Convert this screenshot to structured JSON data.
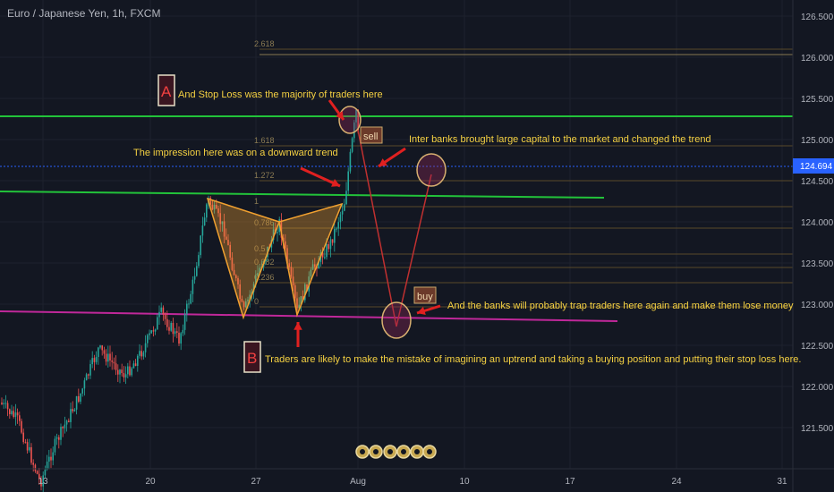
{
  "header": {
    "symbol_title": "Euro / Japanese Yen, 1h, FXCM"
  },
  "price_label": "124.694",
  "chart_data": {
    "type": "candlestick",
    "title": "Euro / Japanese Yen, 1h, FXCM",
    "ylim": [
      121.1,
      126.6
    ],
    "y_ticks": [
      "126.500",
      "126.000",
      "125.500",
      "125.000",
      "124.500",
      "124.000",
      "123.500",
      "123.000",
      "122.500",
      "122.000",
      "121.500"
    ],
    "x_ticks": [
      "13",
      "20",
      "27",
      "Aug",
      "10",
      "17",
      "24",
      "31"
    ],
    "current_price": 124.694,
    "fib_levels": [
      "2.618",
      "1.618",
      "1.272",
      "1",
      "0.786",
      "0.5",
      "0.382",
      "0.236",
      "0"
    ],
    "harmonic_pattern": {
      "type": "bat/gartley (bearish)",
      "color": "#f0a030"
    },
    "horizontal_lines": [
      {
        "name": "resistance",
        "price": 125.28,
        "color": "#22c33a"
      },
      {
        "name": "trendline",
        "from": 124.5,
        "to": 124.32,
        "color": "#22c33a"
      },
      {
        "name": "support-trend",
        "from": 122.93,
        "to": 122.82,
        "color": "#c0289a"
      }
    ],
    "annotations": {
      "label_a": "A",
      "label_b": "B",
      "stop_loss": "And Stop Loss was the majority of traders here",
      "impression": "The impression here was on a downward trend",
      "interbanks": "Inter banks brought large capital to the market and changed the trend",
      "trap": "And the banks will probably trap traders here again and make them lose money",
      "mistake": "Traders are likely to make the mistake of imagining an uptrend and taking a buying position and putting their stop loss here.",
      "sell": "sell",
      "buy": "buy"
    },
    "colors": {
      "up": "#26a69a",
      "down": "#ef5350",
      "background": "#131722",
      "annotation_text": "#f5d142"
    }
  }
}
